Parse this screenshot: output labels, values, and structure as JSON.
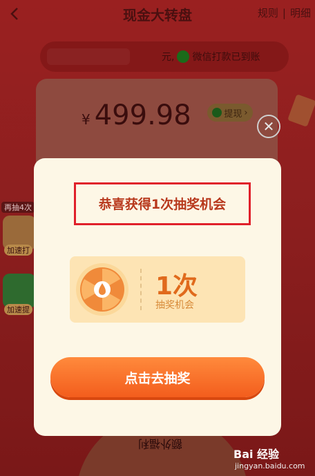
{
  "header": {
    "title": "现金大转盘",
    "rules_link": "规则",
    "details_link": "明细",
    "separator": "|"
  },
  "notice": {
    "comma": "元,",
    "text": "微信打款已到账"
  },
  "balance": {
    "currency": "¥",
    "amount": "499.98",
    "withdraw_label": "提现",
    "withdraw_arrow": "›"
  },
  "side_panel": {
    "tag": "再抽4次",
    "caption_1": "加速打",
    "caption_2": "加速提"
  },
  "wheel": {
    "bottom_text": "额外福利"
  },
  "modal": {
    "title": "恭喜获得1次抽奖机会",
    "chance_count": "1次",
    "chance_label": "抽奖机会",
    "draw_button": "点击去抽奖",
    "close_glyph": "✕"
  },
  "watermark": {
    "brand": "Bai 经验",
    "url": "jingyan.baidu.com"
  },
  "colors": {
    "accent_orange": "#f35d1d",
    "title_red": "#b8391d",
    "highlight_border": "#e0202a",
    "modal_bg": "#fdf7e6"
  }
}
